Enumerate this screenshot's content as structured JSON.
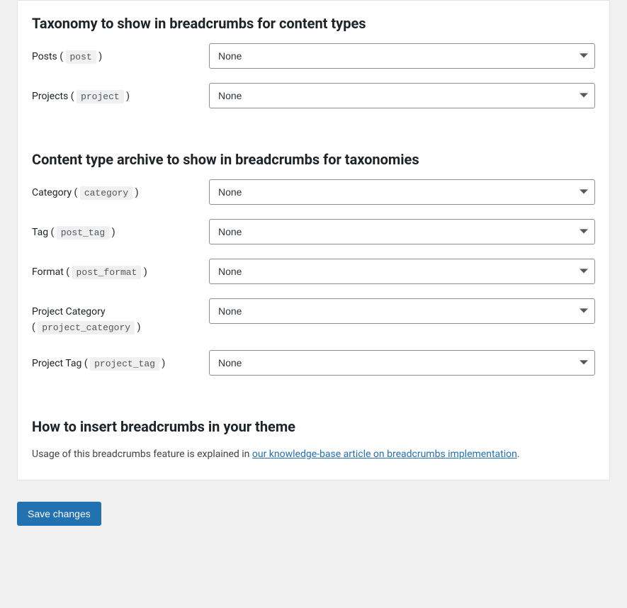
{
  "section1": {
    "title": "Taxonomy to show in breadcrumbs for content types",
    "rows": {
      "posts": {
        "label_prefix": "Posts ( ",
        "code": "post",
        "label_suffix": " )",
        "selected": "None"
      },
      "projects": {
        "label_prefix": "Projects ( ",
        "code": "project",
        "label_suffix": " )",
        "selected": "None"
      }
    }
  },
  "section2": {
    "title": "Content type archive to show in breadcrumbs for taxonomies",
    "rows": {
      "category": {
        "label_prefix": "Category ( ",
        "code": "category",
        "label_suffix": " )",
        "selected": "None"
      },
      "tag": {
        "label_prefix": "Tag ( ",
        "code": "post_tag",
        "label_suffix": " )",
        "selected": "None"
      },
      "format": {
        "label_prefix": "Format ( ",
        "code": "post_format",
        "label_suffix": " )",
        "selected": "None"
      },
      "project_category": {
        "label_prefix": "Project Category",
        "label_prefix2": "( ",
        "code": "project_category",
        "label_suffix": " )",
        "selected": "None"
      },
      "project_tag": {
        "label_prefix": "Project Tag ( ",
        "code": "project_tag",
        "label_suffix": " )",
        "selected": "None"
      }
    }
  },
  "section3": {
    "title": "How to insert breadcrumbs in your theme",
    "help_before": "Usage of this breadcrumbs feature is explained in ",
    "help_link": "our knowledge-base article on breadcrumbs implementation",
    "help_after": "."
  },
  "buttons": {
    "save": "Save changes"
  }
}
